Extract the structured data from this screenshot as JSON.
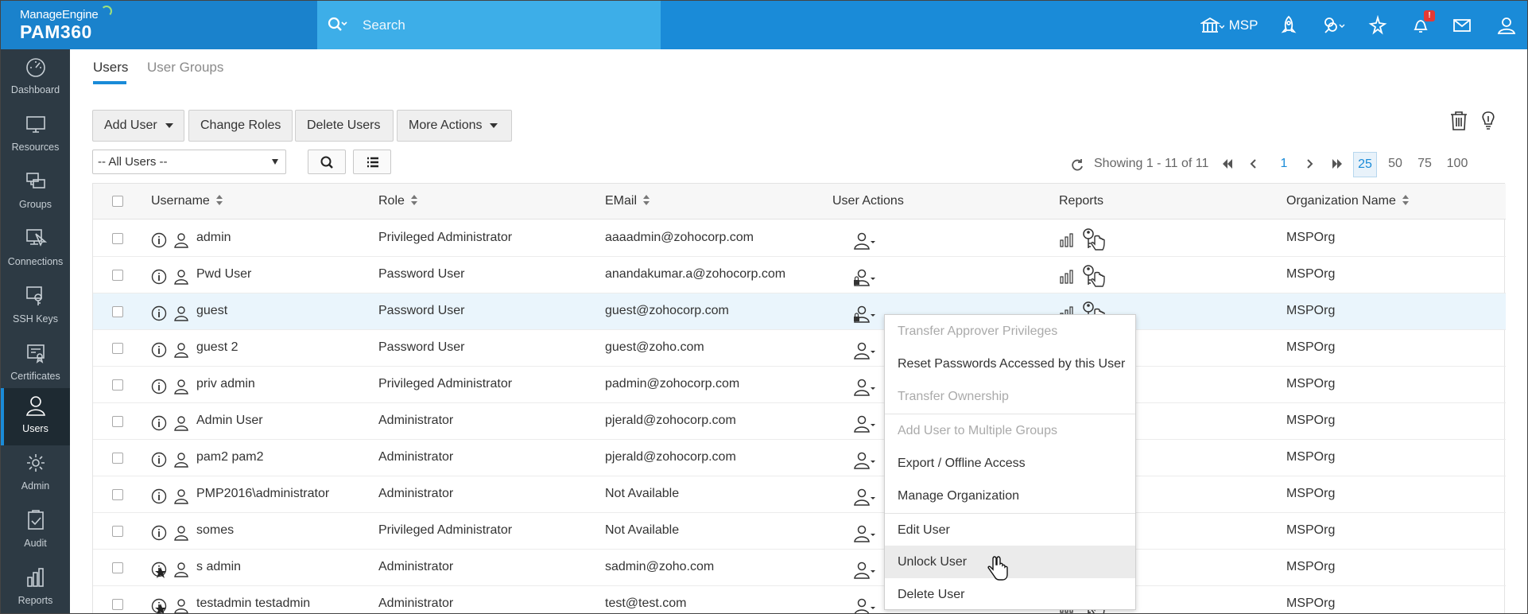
{
  "header": {
    "brand_top": "ManageEngine",
    "brand_product": "PAM360",
    "search_placeholder": "Search",
    "org_label": "MSP",
    "notification_count": "!"
  },
  "sidebar": {
    "items": [
      {
        "label": "Dashboard",
        "icon": "gauge-icon"
      },
      {
        "label": "Resources",
        "icon": "monitor-icon"
      },
      {
        "label": "Groups",
        "icon": "groups-icon"
      },
      {
        "label": "Connections",
        "icon": "connections-icon"
      },
      {
        "label": "SSH Keys",
        "icon": "ssh-key-icon"
      },
      {
        "label": "Certificates",
        "icon": "certificate-icon"
      },
      {
        "label": "Users",
        "icon": "user-icon",
        "active": true
      },
      {
        "label": "Admin",
        "icon": "gear-icon"
      },
      {
        "label": "Audit",
        "icon": "audit-icon"
      },
      {
        "label": "Reports",
        "icon": "reports-icon"
      }
    ]
  },
  "tabs": {
    "users": "Users",
    "user_groups": "User Groups"
  },
  "toolbar": {
    "add_user": "Add User",
    "change_roles": "Change Roles",
    "delete_users": "Delete Users",
    "more_actions": "More Actions",
    "filter_value": "-- All Users --"
  },
  "pagination": {
    "showing": "Showing 1 - 11 of 11",
    "current_page": "1",
    "page_sizes": [
      "25",
      "50",
      "75",
      "100"
    ],
    "selected_size": "25"
  },
  "table": {
    "columns": {
      "username": "Username",
      "role": "Role",
      "email": "EMail",
      "user_actions": "User Actions",
      "reports": "Reports",
      "organization": "Organization Name"
    },
    "rows": [
      {
        "username": "admin",
        "role": "Privileged Administrator",
        "email": "aaaadmin@zohocorp.com",
        "org": "MSPOrg",
        "locked": false,
        "star": false
      },
      {
        "username": "Pwd User",
        "role": "Password User",
        "email": "anandakumar.a@zohocorp.com",
        "org": "MSPOrg",
        "locked": true,
        "star": false
      },
      {
        "username": "guest",
        "role": "Password User",
        "email": "guest@zohocorp.com",
        "org": "MSPOrg",
        "locked": true,
        "star": false,
        "highlighted": true
      },
      {
        "username": "guest 2",
        "role": "Password User",
        "email": "guest@zoho.com",
        "org": "MSPOrg",
        "locked": false,
        "star": false
      },
      {
        "username": "priv admin",
        "role": "Privileged Administrator",
        "email": "padmin@zohocorp.com",
        "org": "MSPOrg",
        "locked": false,
        "star": false
      },
      {
        "username": "Admin User",
        "role": "Administrator",
        "email": "pjerald@zohocorp.com",
        "org": "MSPOrg",
        "locked": false,
        "star": false
      },
      {
        "username": "pam2 pam2",
        "role": "Administrator",
        "email": "pjerald@zohocorp.com",
        "org": "MSPOrg",
        "locked": false,
        "star": false
      },
      {
        "username": "PMP2016\\administrator",
        "role": "Administrator",
        "email": "Not Available",
        "org": "MSPOrg",
        "locked": false,
        "star": false
      },
      {
        "username": "somes",
        "role": "Privileged Administrator",
        "email": "Not Available",
        "org": "MSPOrg",
        "locked": false,
        "star": false
      },
      {
        "username": "s admin",
        "role": "Administrator",
        "email": "sadmin@zoho.com",
        "org": "MSPOrg",
        "locked": false,
        "star": true
      },
      {
        "username": "testadmin testadmin",
        "role": "Administrator",
        "email": "test@test.com",
        "org": "MSPOrg",
        "locked": false,
        "star": true
      }
    ]
  },
  "context_menu": {
    "items": [
      {
        "label": "Transfer Approver Privileges",
        "disabled": true
      },
      {
        "label": "Reset Passwords Accessed by this User",
        "disabled": false
      },
      {
        "label": "Transfer Ownership",
        "disabled": true
      },
      {
        "label": "Add User to Multiple Groups",
        "disabled": true
      },
      {
        "label": "Export / Offline Access",
        "disabled": false
      },
      {
        "label": "Manage Organization",
        "disabled": false
      },
      {
        "label": "Edit User",
        "disabled": false
      },
      {
        "label": "Unlock User",
        "disabled": false,
        "hovered": true
      },
      {
        "label": "Delete User",
        "disabled": false
      }
    ]
  },
  "colors": {
    "header_blue": "#1a8bd8",
    "search_blue": "#3daee8",
    "sidebar_dark": "#2d3a44",
    "row_highlight": "#eaf5fc"
  }
}
